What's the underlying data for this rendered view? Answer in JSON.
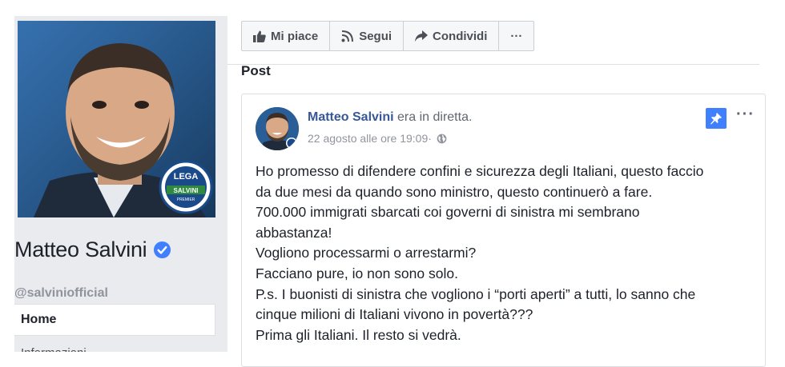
{
  "page": {
    "name": "Matteo Salvini",
    "username": "@salviniofficial",
    "nav": {
      "home": "Home",
      "next": "Informazioni"
    },
    "logo_text": [
      "LEGA",
      "SALVINI",
      "PREMIER"
    ]
  },
  "actions": {
    "like": "Mi piace",
    "follow": "Segui",
    "share": "Condividi",
    "more": "···"
  },
  "section": {
    "title": "Post"
  },
  "post": {
    "author": "Matteo Salvini",
    "header_rest": " era in diretta.",
    "date": "22 agosto alle ore 19:09",
    "separator": " · ",
    "more": "···",
    "lines": [
      "Ho promesso di difendere confini e sicurezza degli Italiani, questo faccio",
      "da due mesi da quando sono ministro, questo continuerò a fare.",
      "700.000 immigrati sbarcati coi governi di sinistra mi sembrano",
      "abbastanza!",
      "Vogliono processarmi o arrestarmi?",
      "Facciano pure, io non sono solo.",
      "P.s. I buonisti di sinistra che vogliono i “porti aperti” a tutti, lo sanno che",
      "cinque milioni di Italiani vivono in povertà???",
      "Prima gli Italiani. Il resto si vedrà."
    ]
  },
  "colors": {
    "link": "#365899",
    "verified": "#4080ff",
    "pin": "#4080ff",
    "sidebar_bg": "#e9ebee"
  },
  "icons": [
    "thumbs-up-icon",
    "rss-icon",
    "share-arrow-icon",
    "more-icon",
    "verified-badge-icon",
    "pin-icon",
    "globe-icon"
  ]
}
